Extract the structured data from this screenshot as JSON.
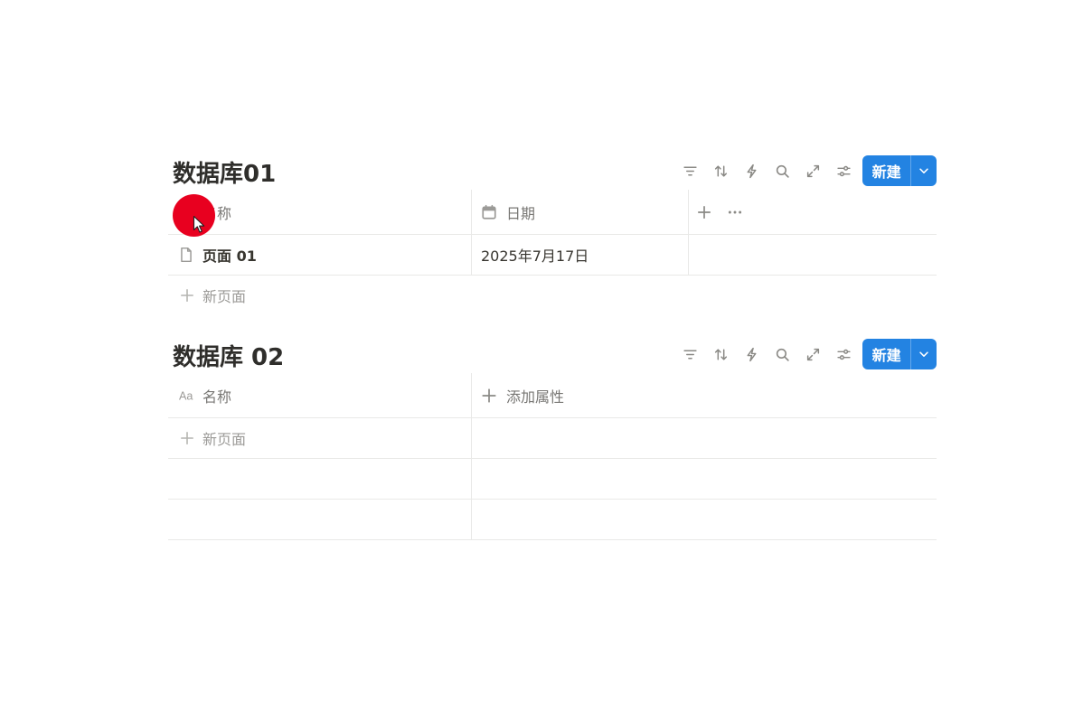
{
  "databases": [
    {
      "title": "数据库01",
      "new_button": "新建",
      "columns": {
        "name": "名称",
        "date": "日期"
      },
      "rows": [
        {
          "name": "页面 01",
          "date": "2025年7月17日"
        }
      ],
      "new_page": "新页面"
    },
    {
      "title": "数据库 02",
      "new_button": "新建",
      "columns": {
        "name": "名称",
        "add_property": "添加属性"
      },
      "rows": [],
      "new_page": "新页面"
    }
  ],
  "icons": {
    "toolbar": [
      "filter-icon",
      "sort-icon",
      "automation-icon",
      "search-icon",
      "expand-icon",
      "settings-icon"
    ],
    "name_column": "text-aa-icon",
    "date_column": "calendar-icon",
    "page": "page-icon"
  },
  "colors": {
    "accent": "#2383e2",
    "cursor_highlight": "#e8001f"
  }
}
